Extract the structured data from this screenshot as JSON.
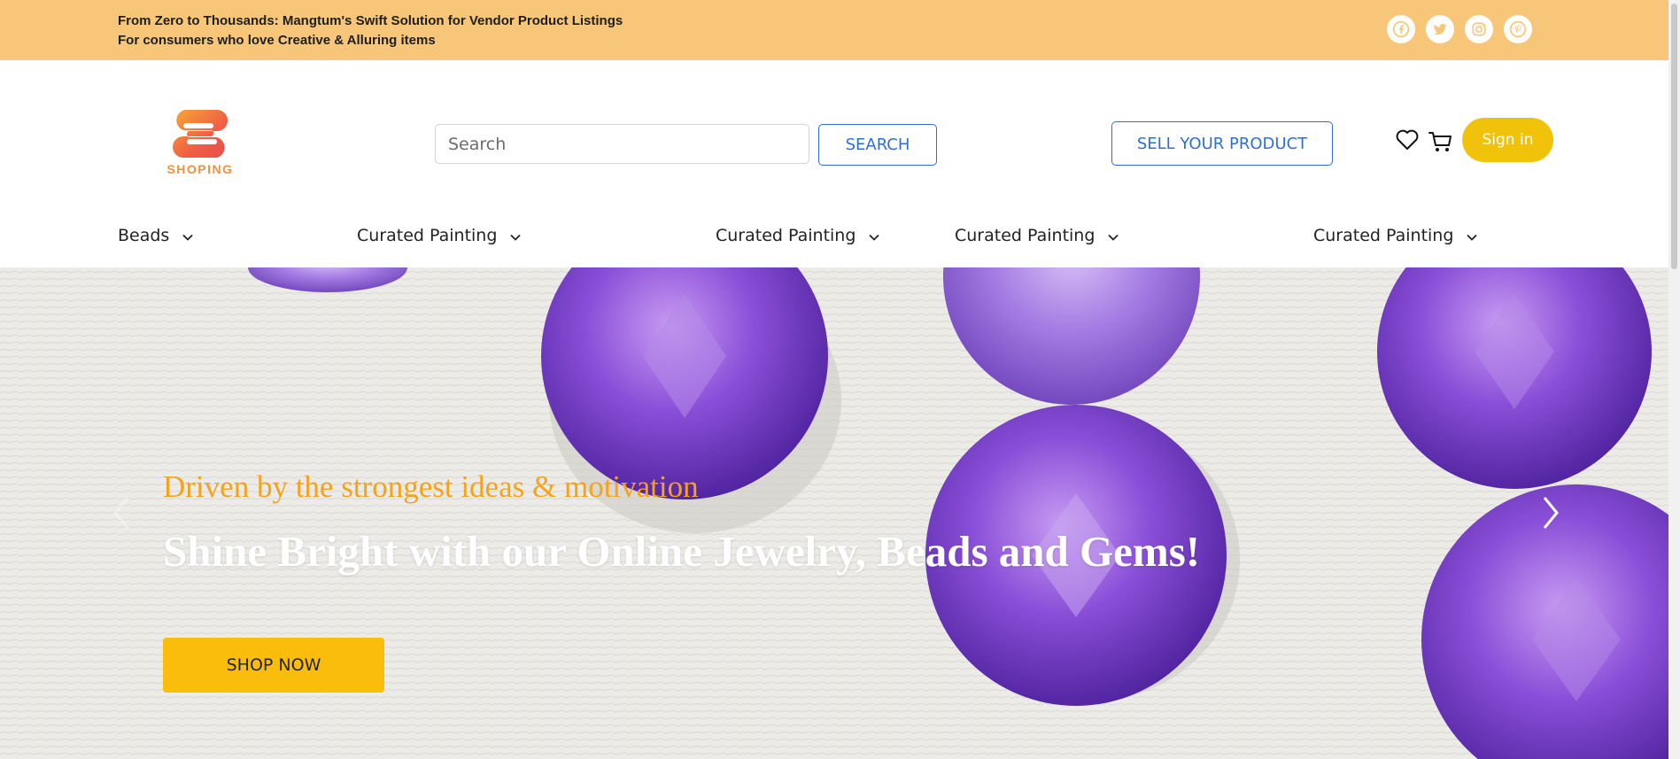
{
  "topbar": {
    "line1": "From Zero to Thousands: Mangtum's Swift Solution for Vendor Product Listings",
    "line2": "For consumers who love Creative & Alluring items",
    "social_icons": [
      "facebook-icon",
      "twitter-icon",
      "instagram-icon",
      "pinterest-icon"
    ],
    "background": "#f7c679"
  },
  "header": {
    "logo_text": "SHOPING",
    "search": {
      "placeholder": "Search",
      "value": ""
    },
    "search_label": "SEARCH",
    "sell_label": "SELL YOUR PRODUCT",
    "signin_label": "Sign in",
    "icons": [
      "heart-icon",
      "cart-icon"
    ]
  },
  "nav": {
    "items": [
      {
        "label": "Beads"
      },
      {
        "label": "Curated Painting"
      },
      {
        "label": "Curated Painting"
      },
      {
        "label": "Curated Painting"
      },
      {
        "label": "Curated Painting"
      }
    ]
  },
  "hero": {
    "kicker": "Driven by the strongest ideas & motivation",
    "title": "Shine Bright with our Online Jewelry, Beads and Gems!",
    "cta_label": "SHOP NOW",
    "colors": {
      "kicker": "#f4a31c",
      "cta": "#fbbd0c"
    }
  },
  "colors": {
    "accent_blue": "#2e6fd6",
    "signin_yellow": "#f0c20a",
    "logo_orange": "#f0923a"
  }
}
